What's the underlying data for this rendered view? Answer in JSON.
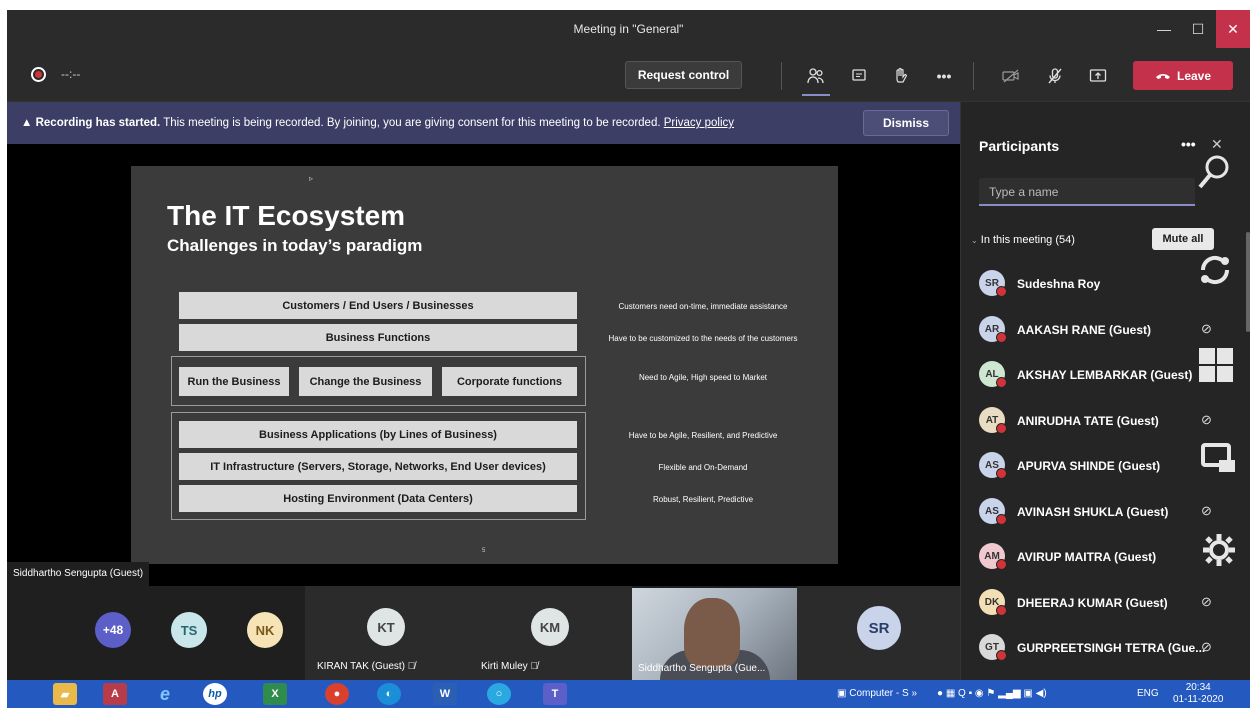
{
  "window": {
    "title": "Meeting in \"General\"",
    "minimize": "—",
    "maximize": "☐",
    "close": "✕"
  },
  "toolbar": {
    "timer": "--:--",
    "request_control": "Request control",
    "leave": "Leave"
  },
  "banner": {
    "heading": "Recording has started.",
    "message": " This meeting is being recorded. By joining, you are giving consent for this meeting to be recorded. ",
    "link": "Privacy policy",
    "dismiss": "Dismiss"
  },
  "slide": {
    "title": "The IT Ecosystem",
    "subtitle": "Challenges in today’s paradigm",
    "rows": [
      {
        "label": "Customers / End Users / Businesses",
        "note": "Customers need on-time, immediate assistance"
      },
      {
        "label": "Business Functions",
        "note": "Have to be customized to the needs of the customers"
      },
      {
        "label": "Run the Business",
        "note": ""
      },
      {
        "label": "Change the Business",
        "note": ""
      },
      {
        "label": "Corporate functions",
        "note": "Need to Agile, High speed to Market"
      },
      {
        "label": "Business Applications (by Lines of Business)",
        "note": "Have to be Agile, Resilient, and Predictive"
      },
      {
        "label": "IT Infrastructure (Servers, Storage, Networks, End User devices)",
        "note": "Flexible and On-Demand"
      },
      {
        "label": "Hosting Environment (Data Centers)",
        "note": "Robust, Resilient, Predictive"
      }
    ],
    "page": "5"
  },
  "speaker_label": "Siddhartho Sengupta (Guest)",
  "tiles": {
    "more": "+48",
    "ts": "TS",
    "nk": "NK",
    "kt": "KT",
    "kt_name": "KIRAN TAK (Guest)",
    "km": "KM",
    "km_name": "Kirti Muley",
    "video_name": "Siddhartho Sengupta (Gue...",
    "sr": "SR"
  },
  "panel": {
    "title": "Participants",
    "more": "•••",
    "close": "✕",
    "search_placeholder": "Type a name",
    "section": "In this meeting (54)",
    "mute_all": "Mute all",
    "participants": [
      {
        "initials": "SR",
        "name": "Sudeshna Roy",
        "color": "#c9d4ea"
      },
      {
        "initials": "AR",
        "name": "AAKASH RANE (Guest)",
        "color": "#c9d4ea"
      },
      {
        "initials": "AL",
        "name": "AKSHAY LEMBARKAR (Guest)",
        "color": "#cfe6d2"
      },
      {
        "initials": "AT",
        "name": "ANIRUDHA TATE (Guest)",
        "color": "#e9dcc2"
      },
      {
        "initials": "AS",
        "name": "APURVA SHINDE (Guest)",
        "color": "#c9d4ea"
      },
      {
        "initials": "AS",
        "name": "AVINASH SHUKLA (Guest)",
        "color": "#c9d4ea"
      },
      {
        "initials": "AM",
        "name": "AVIRUP MAITRA (Guest)",
        "color": "#f0c9d0"
      },
      {
        "initials": "DK",
        "name": "DHEERAJ KUMAR (Guest)",
        "color": "#f2dfb5"
      },
      {
        "initials": "GT",
        "name": "GURPREETSINGH TETRA (Gue...",
        "color": "#d9d9d9"
      }
    ]
  },
  "taskbar": {
    "tray_app": "Computer - S",
    "lang": "ENG",
    "time": "20:34",
    "date": "01-11-2020"
  }
}
